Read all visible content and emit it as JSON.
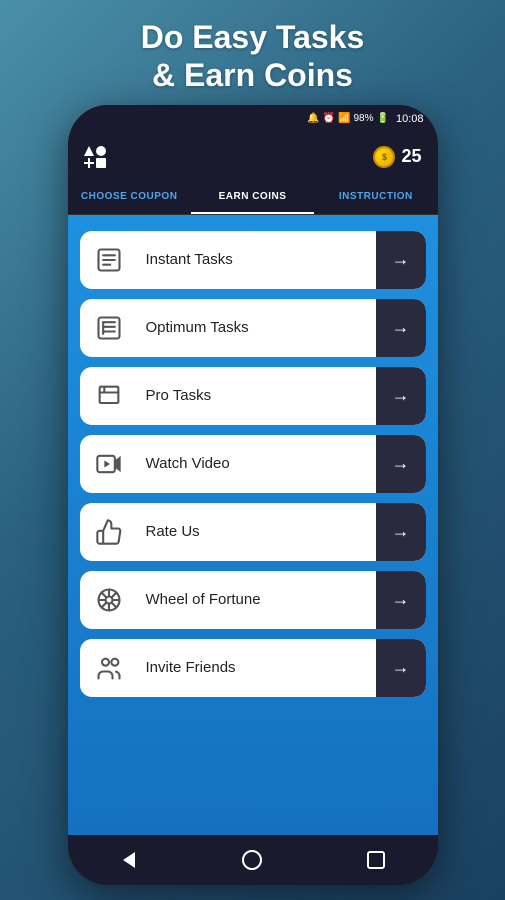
{
  "header": {
    "title_line1": "Do Easy Tasks",
    "title_line2": "& Earn Coins",
    "coin_count": "25"
  },
  "status_bar": {
    "battery": "98%",
    "time": "10:08"
  },
  "tabs": [
    {
      "id": "choose-coupon",
      "label": "CHOOSE COUPON",
      "active": false
    },
    {
      "id": "earn-coins",
      "label": "EARN COINS",
      "active": true
    },
    {
      "id": "instruction",
      "label": "INSTRUCTION",
      "active": false
    }
  ],
  "tasks": [
    {
      "id": "instant-tasks",
      "label": "Instant Tasks",
      "icon": "list-icon"
    },
    {
      "id": "optimum-tasks",
      "label": "Optimum Tasks",
      "icon": "grid-icon"
    },
    {
      "id": "pro-tasks",
      "label": "Pro Tasks",
      "icon": "layers-icon"
    },
    {
      "id": "watch-video",
      "label": "Watch Video",
      "icon": "video-icon"
    },
    {
      "id": "rate-us",
      "label": "Rate Us",
      "icon": "thumbsup-icon"
    },
    {
      "id": "wheel-of-fortune",
      "label": "Wheel of Fortune",
      "icon": "wheel-icon"
    },
    {
      "id": "invite-friends",
      "label": "Invite Friends",
      "icon": "friends-icon"
    }
  ],
  "nav": {
    "back_label": "back",
    "home_label": "home",
    "recents_label": "recents"
  }
}
